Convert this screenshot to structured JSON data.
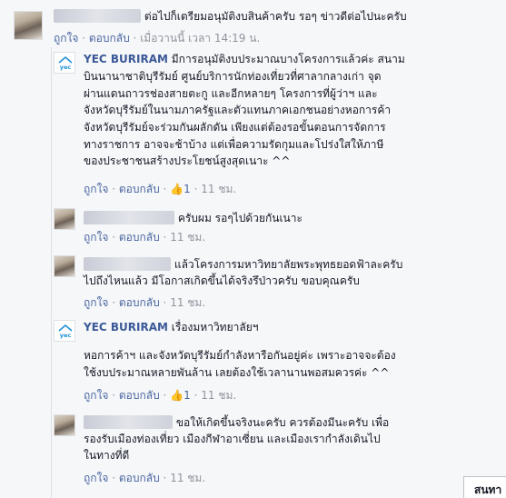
{
  "comments": [
    {
      "text": "ต่อไปก็เตรียมอนุมัติงบสินค้าครับ รอๆ ข่าวดีต่อไปนะครับ",
      "like_label": "ถูกใจ",
      "reply_label": "ตอบกลับ",
      "time": "เมื่อวานนี้ เวลา 14:19 น."
    }
  ],
  "replies": [
    {
      "author": "YEC BURIRAM",
      "lines": [
        "มีการอนุมัติงบประมาณบางโครงการแล้วค่ะ สนาม",
        "บินนานาชาติบุรีรัมย์ ศูนย์บริการนักท่องเที่ยวที่ศาลากลางเก่า จุด",
        "ผ่านแดนถาวรช่องสายตะกู และอีกหลายๆ โครงการที่ผู้ว่าฯ และ",
        "จังหวัดบุรีรัมย์ในนามภาครัฐและตัวแทนภาคเอกชนอย่างหอการค้า",
        "จังหวัดบุรีรัมย์จะร่วมกันผลักดัน เพียงแต่ต้องรอขั้นตอนการจัดการ",
        "ทางราชการ อาจจะช้าบ้าง แต่เพื่อความรัดกุมและโปร่งใสให้ภาษี",
        "ของประชาชนสร้างประโยชน์สูงสุดเนาะ ^^"
      ],
      "like_label": "ถูกใจ",
      "reply_label": "ตอบกลับ",
      "likes": "1",
      "time": "11 ชม."
    },
    {
      "lines": [
        "ครับผม รอๆไปด้วยกันเนาะ"
      ],
      "like_label": "ถูกใจ",
      "reply_label": "ตอบกลับ",
      "time": "11 ชม."
    },
    {
      "lines": [
        "แล้วโครงการมหาวิทยาลัยพระพุทธยอดฟ้าละครับ",
        "ไปถึงไหนแล้ว มีโอกาสเกิดขึ้นได้จริงรึป่าวครับ ขอบคุณครับ"
      ],
      "like_label": "ถูกใจ",
      "reply_label": "ตอบกลับ",
      "time": "11 ชม."
    },
    {
      "author": "YEC BURIRAM",
      "lines": [
        "เรื่องมหาวิทยาลัยฯ",
        "หอการค้าฯ และจังหวัดบุรีรัมย์กำลังหารือกันอยู่ค่ะ เพราะอาจจะต้อง",
        "ใช้งบประมาณหลายพันล้าน เลยต้องใช้เวลานานพอสมควรค่ะ ^^"
      ],
      "like_label": "ถูกใจ",
      "reply_label": "ตอบกลับ",
      "likes": "1",
      "time": "11 ชม."
    },
    {
      "lines": [
        "ขอให้เกิดขึ้นจริงนะครับ ควรต้องมีนะครับ เพื่อ",
        "รองรับเมืองท่องเที่ยว เมืองกีฬาอาเซี่ยน และเมืองเรากำลังเดินไป",
        "ในทางที่ดี"
      ],
      "like_label": "ถูกใจ",
      "reply_label": "ตอบกลับ",
      "time": "11 ชม."
    }
  ],
  "yec_logo_text": "yec",
  "bottom_tab_label": "สนทา",
  "icons": {
    "like": "thumbs-up-icon"
  },
  "colors": {
    "link": "#3b5998",
    "meta": "#90949c",
    "like": "#4267b2"
  }
}
